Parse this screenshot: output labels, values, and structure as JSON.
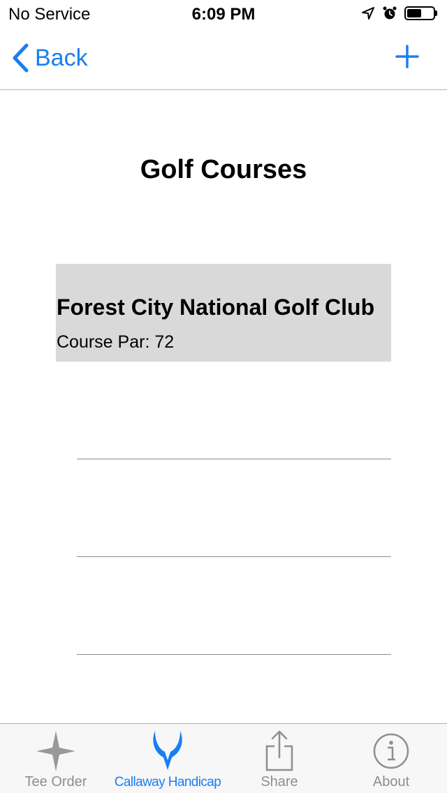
{
  "status_bar": {
    "carrier": "No Service",
    "time": "6:09 PM",
    "icons": [
      "location-arrow-icon",
      "alarm-icon",
      "battery-icon"
    ],
    "battery_level": 0.55
  },
  "nav": {
    "back_label": "Back",
    "add_icon": "plus-icon",
    "accent_color": "#1a7ef2"
  },
  "page": {
    "title": "Golf Courses"
  },
  "courses": [
    {
      "name": "Forest City National Golf Club",
      "par_label": "Course Par: 72",
      "selected": true
    }
  ],
  "tabs": [
    {
      "label": "Tee Order",
      "icon": "star-icon",
      "active": false
    },
    {
      "label": "Callaway Handicap",
      "icon": "callaway-logo-icon",
      "active": true
    },
    {
      "label": "Share",
      "icon": "share-icon",
      "active": false
    },
    {
      "label": "About",
      "icon": "info-icon",
      "active": false
    }
  ]
}
